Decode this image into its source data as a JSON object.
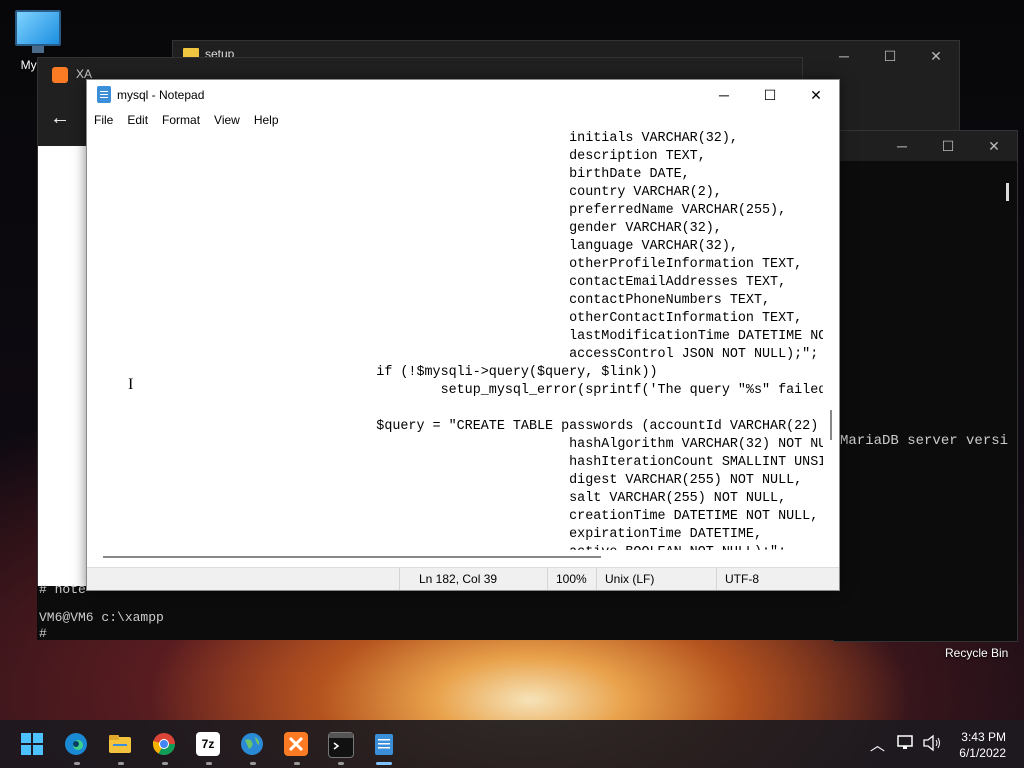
{
  "desktop": {
    "icons": [
      {
        "label": "My Co"
      },
      {
        "label": "Recycle Bin"
      }
    ]
  },
  "windows": {
    "setup": {
      "title": "setup"
    },
    "xampp": {
      "title": "XA"
    },
    "terminal": {
      "visible_text": "MariaDB server versi",
      "bottom_lines": [
        "# note",
        "VM6@VM6 c:\\xampp",
        "#"
      ]
    }
  },
  "caption_glyphs": {
    "minimize": "─",
    "maximize": "☐",
    "close": "✕"
  },
  "notepad": {
    "title": "mysql - Notepad",
    "menu": [
      "File",
      "Edit",
      "Format",
      "View",
      "Help"
    ],
    "code": "                                                            initials VARCHAR(32),\n                                                            description TEXT,\n                                                            birthDate DATE,\n                                                            country VARCHAR(2),\n                                                            preferredName VARCHAR(255),\n                                                            gender VARCHAR(32),\n                                                            language VARCHAR(32),\n                                                            otherProfileInformation TEXT,\n                                                            contactEmailAddresses TEXT,\n                                                            contactPhoneNumbers TEXT,\n                                                            otherContactInformation TEXT,\n                                                            lastModificationTime DATETIME NOT N\n                                                            accessControl JSON NOT NULL);\";\n                                    if (!$mysqli->query($query, $link))\n                                            setup_mysql_error(sprintf('The query \"%s\" failed.',\n\n                                    $query = \"CREATE TABLE passwords (accountId VARCHAR(22) PRI\n                                                            hashAlgorithm VARCHAR(32) NOT NULL,\n                                                            hashIterationCount SMALLINT UNSIGNE\n                                                            digest VARCHAR(255) NOT NULL,\n                                                            salt VARCHAR(255) NOT NULL,\n                                                            creationTime DATETIME NOT NULL,\n                                                            expirationTime DATETIME,\n                                                            active BOOLEAN NOT NULL);\";",
    "status": {
      "position": "Ln 182, Col 39",
      "zoom": "100%",
      "line_ending": "Unix (LF)",
      "encoding": "UTF-8"
    }
  },
  "taskbar": {
    "apps": [
      "start-icon",
      "edge-icon",
      "file-explorer-icon",
      "chrome-icon",
      "7zip-icon",
      "network-globe-icon",
      "xampp-icon",
      "terminal-icon",
      "notepad-icon"
    ],
    "labels": {
      "sevenzip": "7z"
    },
    "tray": {
      "chevron": "︿"
    },
    "clock": {
      "time": "3:43 PM",
      "date": "6/1/2022"
    }
  },
  "colors": {
    "accent": "#7cc3ff",
    "xampp_orange": "#fb7a24",
    "notepad_blue": "#3a8fd8"
  }
}
